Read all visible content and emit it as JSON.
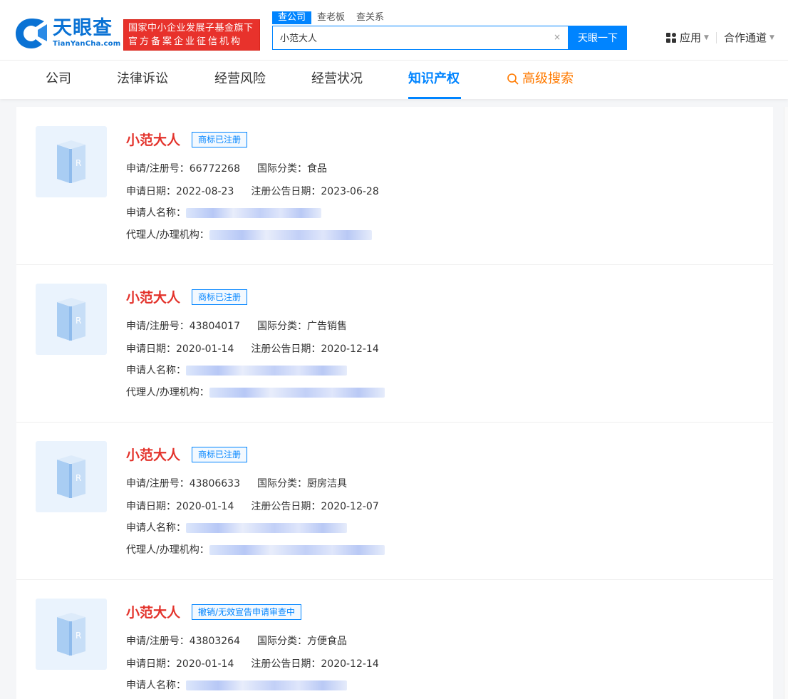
{
  "brand": {
    "name_cn": "天眼查",
    "name_en": "TianYanCha.com",
    "badge_line1": "国家中小企业发展子基金旗下",
    "badge_line2": "官方备案企业征信机构"
  },
  "search": {
    "tabs": [
      "查公司",
      "查老板",
      "查关系"
    ],
    "value": "小范大人",
    "clear": "×",
    "button": "天眼一下"
  },
  "top_menu": {
    "apps": "应用",
    "partner": "合作通道"
  },
  "nav": {
    "items": [
      "公司",
      "法律诉讼",
      "经营风险",
      "经营状况",
      "知识产权"
    ],
    "advanced_search": "高级搜索"
  },
  "colors": {
    "brand_blue": "#0084ff",
    "name_red": "#e3322b",
    "badge_red": "#e8322c",
    "search_orange": "#ff7a00"
  },
  "labels": {
    "reg_no": "申请/注册号：",
    "category": "国际分类：",
    "apply_date": "申请日期：",
    "pub_date": "注册公告日期：",
    "applicant": "申请人名称：",
    "agent": "代理人/办理机构："
  },
  "results": [
    {
      "name": "小范大人",
      "status": "商标已注册",
      "reg_no": "66772268",
      "category": "食品",
      "apply_date": "2022-08-23",
      "pub_date": "2023-06-28"
    },
    {
      "name": "小范大人",
      "status": "商标已注册",
      "reg_no": "43804017",
      "category": "广告销售",
      "apply_date": "2020-01-14",
      "pub_date": "2020-12-14"
    },
    {
      "name": "小范大人",
      "status": "商标已注册",
      "reg_no": "43806633",
      "category": "厨房洁具",
      "apply_date": "2020-01-14",
      "pub_date": "2020-12-07"
    },
    {
      "name": "小范大人",
      "status": "撤销/无效宣告申请审查中",
      "reg_no": "43803264",
      "category": "方便食品",
      "apply_date": "2020-01-14",
      "pub_date": "2020-12-14"
    }
  ]
}
